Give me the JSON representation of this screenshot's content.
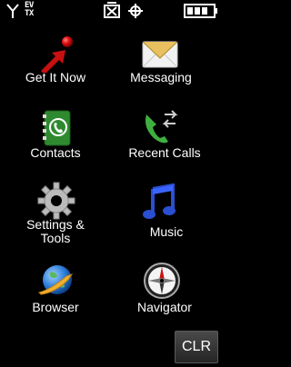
{
  "status": {
    "ev_label": "EV",
    "tx_label": "TX",
    "icons": [
      "signal-icon",
      "no-sim-icon",
      "gps-icon",
      "battery-icon"
    ]
  },
  "menu": {
    "items": [
      {
        "label": "Get It Now",
        "icon": "get-it-now-icon"
      },
      {
        "label": "Messaging",
        "icon": "envelope-icon"
      },
      {
        "label": "Contacts",
        "icon": "contacts-book-icon"
      },
      {
        "label": "Recent Calls",
        "icon": "recent-calls-icon"
      },
      {
        "label": "Settings &",
        "label2": "Tools",
        "icon": "gear-icon"
      },
      {
        "label": "Music",
        "icon": "music-note-icon"
      },
      {
        "label": "Browser",
        "icon": "globe-icon"
      },
      {
        "label": "Navigator",
        "icon": "compass-icon"
      }
    ]
  },
  "softkey": {
    "clr_label": "CLR"
  },
  "colors": {
    "background": "#000000",
    "text": "#ffffff",
    "accent_red": "#cc1111"
  }
}
